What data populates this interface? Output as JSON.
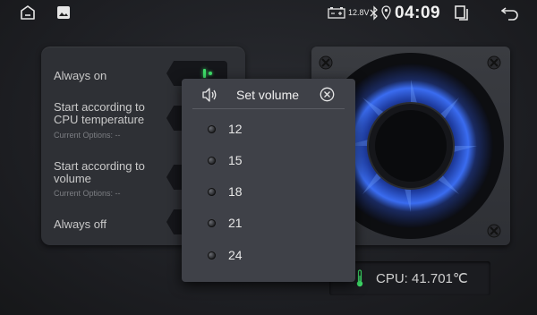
{
  "status_bar": {
    "voltage": "12.8V",
    "time": "04:09",
    "icons": [
      "home-icon",
      "gallery-icon",
      "battery-icon",
      "bluetooth-icon",
      "location-icon",
      "recent-apps-icon",
      "back-icon"
    ]
  },
  "options": [
    {
      "label": "Always on",
      "sub": ""
    },
    {
      "label": "Start according to CPU temperature",
      "sub": "Current Options: --"
    },
    {
      "label": "Start according to volume",
      "sub": "Current Options: --"
    },
    {
      "label": "Always off",
      "sub": ""
    }
  ],
  "cpu": {
    "text": "CPU: 41.701℃"
  },
  "dialog": {
    "title": "Set volume",
    "options": [
      "12",
      "15",
      "18",
      "21",
      "24"
    ]
  },
  "colors": {
    "led_green": "#3fe06a",
    "fan_blue": "#3a6cf0"
  }
}
